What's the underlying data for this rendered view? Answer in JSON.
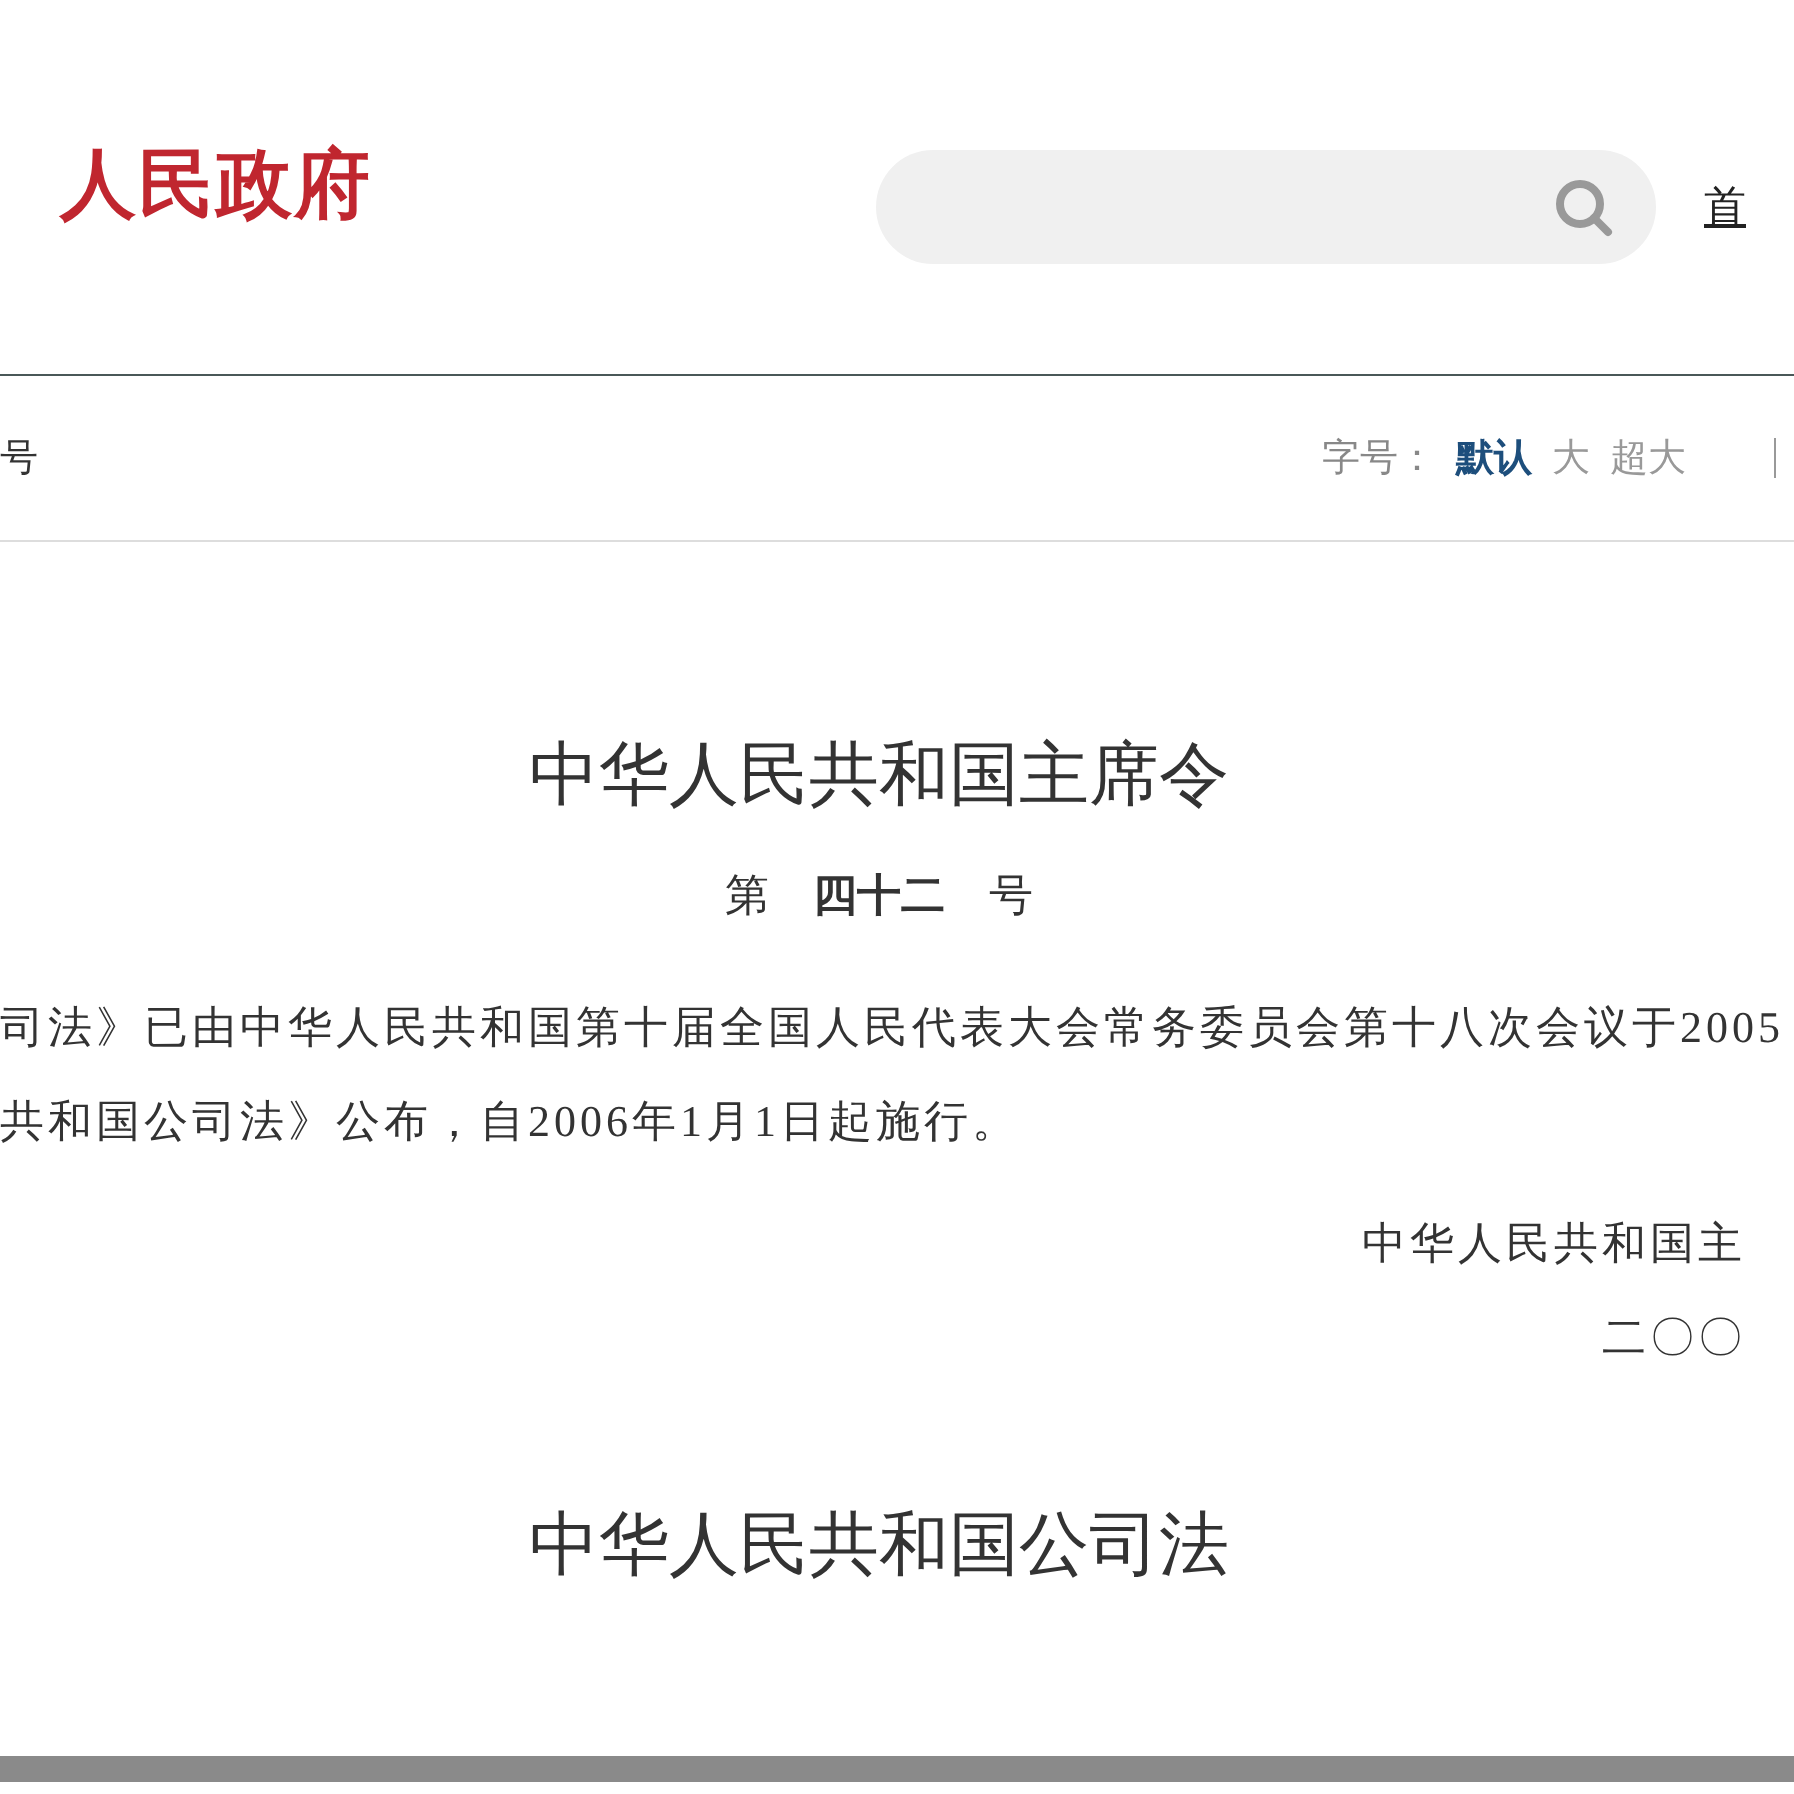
{
  "header": {
    "logo_text": "人民政府",
    "nav": [
      "首"
    ]
  },
  "toolbar": {
    "left_text": "号",
    "font_size": {
      "label": "字号：",
      "options": [
        {
          "label": "默认",
          "selected": true
        },
        {
          "label": "大",
          "selected": false
        },
        {
          "label": "超大",
          "selected": false
        }
      ]
    }
  },
  "article": {
    "title": "中华人民共和国主席令",
    "number": {
      "prefix": "第",
      "value": "四十二",
      "suffix": "号"
    },
    "paragraphs": [
      "司法》已由中华人民共和国第十届全国人民代表大会常务委员会第十八次会议于2005",
      "共和国公司法》公布，自2006年1月1日起施行。"
    ],
    "signature": [
      "中华人民共和国主",
      "二〇〇"
    ],
    "law_title": "中华人民共和国公司法"
  }
}
